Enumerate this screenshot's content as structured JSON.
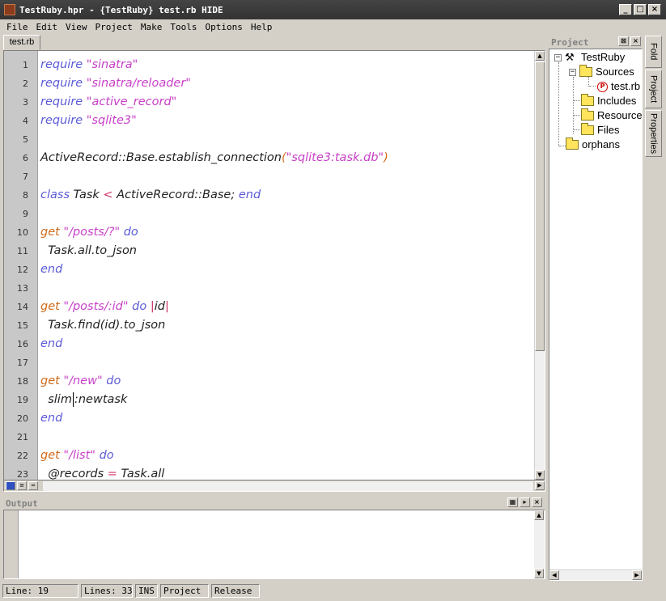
{
  "window": {
    "title": "TestRuby.hpr - {TestRuby} test.rb   HIDE",
    "buttons": [
      "_",
      "□",
      "×"
    ]
  },
  "menu": [
    "File",
    "Edit",
    "View",
    "Project",
    "Make",
    "Tools",
    "Options",
    "Help"
  ],
  "editor": {
    "tab_label": "test.rb",
    "lines": [
      {
        "n": "1",
        "tokens": [
          [
            "kw",
            "require"
          ],
          [
            "",
            " "
          ],
          [
            "str",
            "\"sinatra\""
          ]
        ]
      },
      {
        "n": "2",
        "tokens": [
          [
            "kw",
            "require"
          ],
          [
            "",
            " "
          ],
          [
            "str",
            "\"sinatra/reloader\""
          ]
        ]
      },
      {
        "n": "3",
        "tokens": [
          [
            "kw",
            "require"
          ],
          [
            "",
            " "
          ],
          [
            "str",
            "\"active_record\""
          ]
        ]
      },
      {
        "n": "4",
        "tokens": [
          [
            "kw",
            "require"
          ],
          [
            "",
            " "
          ],
          [
            "str",
            "\"sqlite3\""
          ]
        ]
      },
      {
        "n": "5",
        "tokens": []
      },
      {
        "n": "6",
        "tokens": [
          [
            "",
            "ActiveRecord::Base.establish_connection"
          ],
          [
            "fn",
            "("
          ],
          [
            "str",
            "\"sqlite3:task.db\""
          ],
          [
            "fn",
            ")"
          ]
        ]
      },
      {
        "n": "7",
        "tokens": []
      },
      {
        "n": "8",
        "tokens": [
          [
            "kw",
            "class"
          ],
          [
            "",
            " Task "
          ],
          [
            "op",
            "<"
          ],
          [
            "",
            " ActiveRecord::Base; "
          ],
          [
            "kw",
            "end"
          ]
        ]
      },
      {
        "n": "9",
        "tokens": []
      },
      {
        "n": "10",
        "tokens": [
          [
            "fn",
            "get"
          ],
          [
            "",
            " "
          ],
          [
            "str",
            "\"/posts/?\""
          ],
          [
            "",
            " "
          ],
          [
            "kw",
            "do"
          ]
        ]
      },
      {
        "n": "11",
        "tokens": [
          [
            "",
            "  Task.all.to_json"
          ]
        ]
      },
      {
        "n": "12",
        "tokens": [
          [
            "kw",
            "end"
          ]
        ]
      },
      {
        "n": "13",
        "tokens": []
      },
      {
        "n": "14",
        "tokens": [
          [
            "fn",
            "get"
          ],
          [
            "",
            " "
          ],
          [
            "str",
            "\"/posts/:id\""
          ],
          [
            "",
            " "
          ],
          [
            "kw",
            "do"
          ],
          [
            "",
            " "
          ],
          [
            "op",
            "|"
          ],
          [
            "",
            "id"
          ],
          [
            "op",
            "|"
          ]
        ]
      },
      {
        "n": "15",
        "tokens": [
          [
            "",
            "  Task.find(id).to_json"
          ]
        ]
      },
      {
        "n": "16",
        "tokens": [
          [
            "kw",
            "end"
          ]
        ]
      },
      {
        "n": "17",
        "tokens": []
      },
      {
        "n": "18",
        "tokens": [
          [
            "fn",
            "get"
          ],
          [
            "",
            " "
          ],
          [
            "str",
            "\"/new\""
          ],
          [
            "",
            " "
          ],
          [
            "kw",
            "do"
          ]
        ]
      },
      {
        "n": "19",
        "tokens": [
          [
            "",
            "  slim"
          ],
          [
            "caret",
            ""
          ],
          [
            "",
            ":newtask"
          ]
        ]
      },
      {
        "n": "20",
        "tokens": [
          [
            "kw",
            "end"
          ]
        ]
      },
      {
        "n": "21",
        "tokens": []
      },
      {
        "n": "22",
        "tokens": [
          [
            "fn",
            "get"
          ],
          [
            "",
            " "
          ],
          [
            "str",
            "\"/list\""
          ],
          [
            "",
            " "
          ],
          [
            "kw",
            "do"
          ]
        ]
      },
      {
        "n": "23",
        "tokens": [
          [
            "",
            "  @records "
          ],
          [
            "op",
            "="
          ],
          [
            "",
            " Task.all"
          ]
        ]
      }
    ]
  },
  "output": {
    "title": "Output"
  },
  "project": {
    "title": "Project",
    "tree": {
      "root": "TestRuby",
      "sources": "Sources",
      "file": "test.rb",
      "includes": "Includes",
      "resources": "Resources",
      "files": "Files",
      "orphans": "orphans"
    }
  },
  "side_tabs": [
    "Fold",
    "Project",
    "Properties"
  ],
  "status": {
    "line": "Line: 19",
    "lines": "Lines: 33",
    "mode": "INS",
    "project": "Project",
    "build": "Release"
  }
}
